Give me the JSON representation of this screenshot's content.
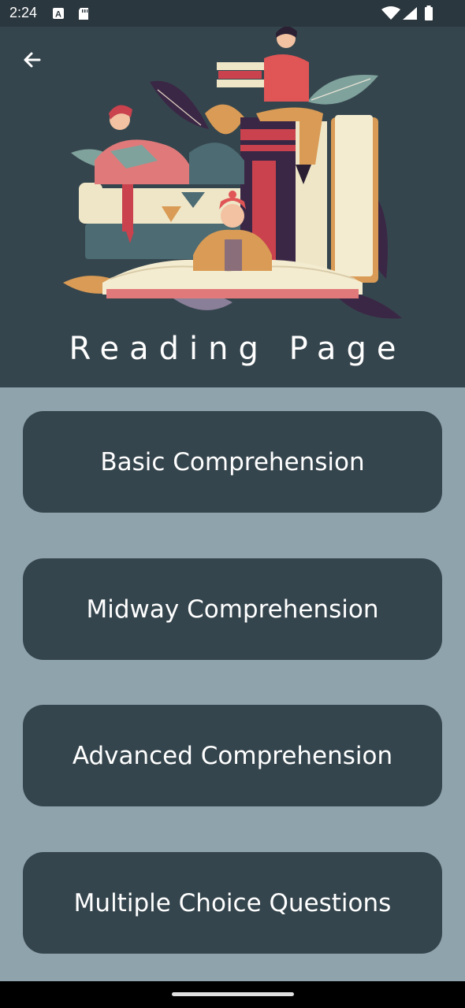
{
  "status_bar": {
    "time": "2:24",
    "icons": [
      "a-notification-icon",
      "sd-card-icon",
      "wifi-icon",
      "signal-icon",
      "battery-icon"
    ]
  },
  "header": {
    "back_icon": "arrow-back-icon",
    "title": "Reading Page",
    "illustration": "reading-people-books-illustration"
  },
  "options": [
    {
      "label": "Basic Comprehension"
    },
    {
      "label": "Midway Comprehension"
    },
    {
      "label": "Advanced Comprehension"
    },
    {
      "label": "Multiple Choice Questions"
    }
  ],
  "colors": {
    "status_bar": "#2b373e",
    "header_bg": "#35454d",
    "page_bg": "#8fa3ad",
    "button_bg": "#35454d",
    "text": "#ffffff"
  }
}
